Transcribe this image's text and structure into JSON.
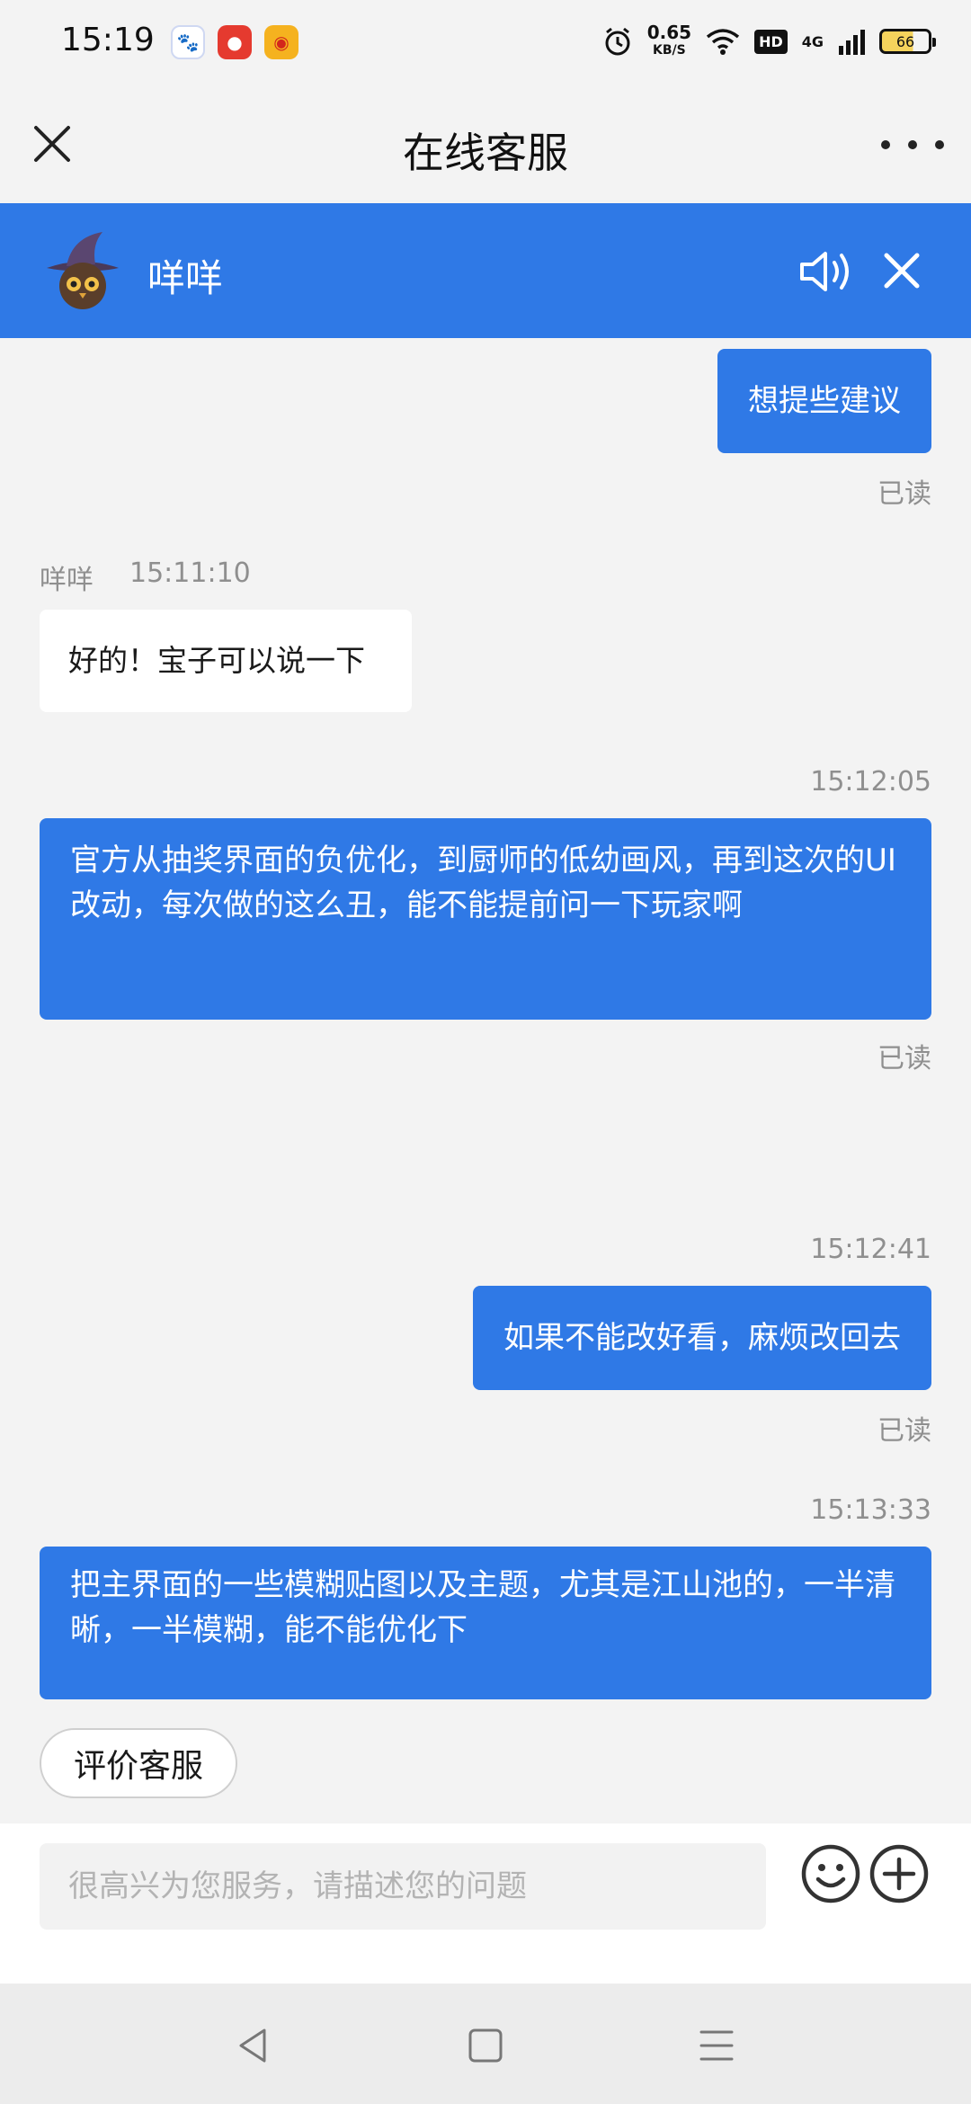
{
  "status_bar": {
    "time": "15:19",
    "net_speed_value": "0.65",
    "net_speed_unit": "KB/S",
    "hd_label": "HD",
    "signal_label": "4G",
    "battery_level": "66"
  },
  "title_bar": {
    "title": "在线客服"
  },
  "agent": {
    "name": "咩咩"
  },
  "messages": [
    {
      "direction": "out",
      "text": "想提些建议",
      "status": "已读"
    },
    {
      "direction": "in",
      "sender": "咩咩",
      "time": "15:11:10",
      "text": "好的！宝子可以说一下"
    },
    {
      "direction": "out",
      "time": "15:12:05",
      "text": "官方从抽奖界面的负优化，到厨师的低幼画风，再到这次的UI改动，每次做的这么丑，能不能提前问一下玩家啊",
      "status": "已读"
    },
    {
      "direction": "out",
      "time": "15:12:41",
      "text": "如果不能改好看，麻烦改回去",
      "status": "已读"
    },
    {
      "direction": "out",
      "time": "15:13:33",
      "text": "把主界面的一些模糊贴图以及主题，尤其是江山池的，一半清晰，一半模糊，能不能优化下"
    }
  ],
  "rate_button": {
    "label": "评价客服"
  },
  "input": {
    "placeholder": "很高兴为您服务，请描述您的问题",
    "value": ""
  },
  "colors": {
    "accent": "#2f79e6",
    "background": "#f3f3f3",
    "meta_text": "#8f8f8f"
  }
}
